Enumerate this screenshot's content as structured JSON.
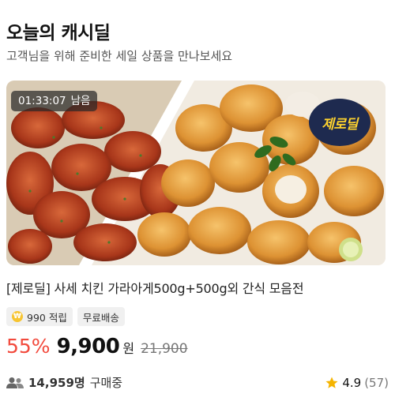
{
  "header": {
    "title": "오늘의 캐시딜",
    "subtitle": "고객님을 위해 준비한 세일 상품을 만나보세요"
  },
  "deal": {
    "timer_value": "01:33:07",
    "timer_suffix": "남음",
    "logo_text": "제로딜",
    "product_name": "[제로딜] 사세 치킨 가라아게500g+500g외 간식 모음전",
    "points_label": "990 적립",
    "shipping_label": "무료배송",
    "discount": "55%",
    "price": "9,900",
    "currency": "원",
    "original_price": "21,900",
    "buyers_count": "14,959명",
    "buyers_suffix": "구매중",
    "rating": "4.9",
    "review_count": "(57)"
  },
  "icons": {
    "coin": "coin-icon",
    "people": "people-icon",
    "star": "star-icon"
  },
  "colors": {
    "discount": "#f24a3d",
    "star": "#f5b400",
    "coin": "#f7c531"
  }
}
